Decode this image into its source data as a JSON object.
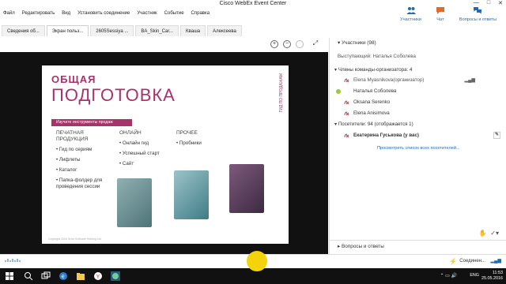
{
  "window": {
    "title": "Cisco WebEx Event Center",
    "controls": [
      "—",
      "□",
      "✕"
    ]
  },
  "menu": [
    "Файл",
    "Редактировать",
    "Вид",
    "Установить соединение",
    "Участник",
    "Событие",
    "Справка"
  ],
  "quick_tabs": [
    {
      "label": "Участники",
      "icon": "participants-icon"
    },
    {
      "label": "Чат",
      "icon": "chat-icon"
    },
    {
      "label": "Вопросы и ответы",
      "icon": "qa-icon"
    }
  ],
  "tabs": [
    {
      "label": "Сведения об..."
    },
    {
      "label": "Экран польз..."
    },
    {
      "label": "2605Sessiya ..."
    },
    {
      "label": "BA_Skin_Car..."
    },
    {
      "label": "Кваша"
    },
    {
      "label": "Алексеева"
    }
  ],
  "slide": {
    "heading1": "ОБЩАЯ",
    "heading2": "ПОДГОТОВКА",
    "side_label": "ГИД ПО ПРОДАЖАМ",
    "strip": "Изучите инструменты продаж",
    "col1": {
      "h": "ПЕЧАТНАЯ ПРОДУКЦИЯ",
      "items": [
        "Гид по сериям",
        "Лифлеты",
        "Каталог",
        "Папка-фолдер для проведения сессии"
      ]
    },
    "col2": {
      "h": "ОНЛАЙН",
      "items": [
        "Онлайн гид",
        "Успешный старт",
        "Сайт"
      ]
    },
    "col3": {
      "h": "ПРОЧЕЕ",
      "items": [
        "Пробники"
      ]
    },
    "footer": "Copyright 2016 Grow Software Holding Ltd."
  },
  "participants": {
    "header": "Участники (98)",
    "speaker": "Выступающий: Наталья Соболева",
    "hosts_section": "Члены команды-организатора: 4",
    "hosts": [
      {
        "name": "Elena Myasnikova(организатор)"
      },
      {
        "name": "Наталья Соболева"
      },
      {
        "name": "Oksana Serenko"
      },
      {
        "name": "Elena Anisimova"
      }
    ],
    "attendees_section": "Посетители: 94 (отображается 1)",
    "attendees": [
      {
        "name": "Екатерина Гуськова (у вас)"
      }
    ],
    "link": "Просмотреть список всех посетителей..."
  },
  "qa_panel": {
    "label": "Вопросы и ответы"
  },
  "status": {
    "connection": "Соединен..."
  },
  "taskbar": {
    "lang": "ENG",
    "time": "11:53",
    "date": "25.05.2016"
  }
}
